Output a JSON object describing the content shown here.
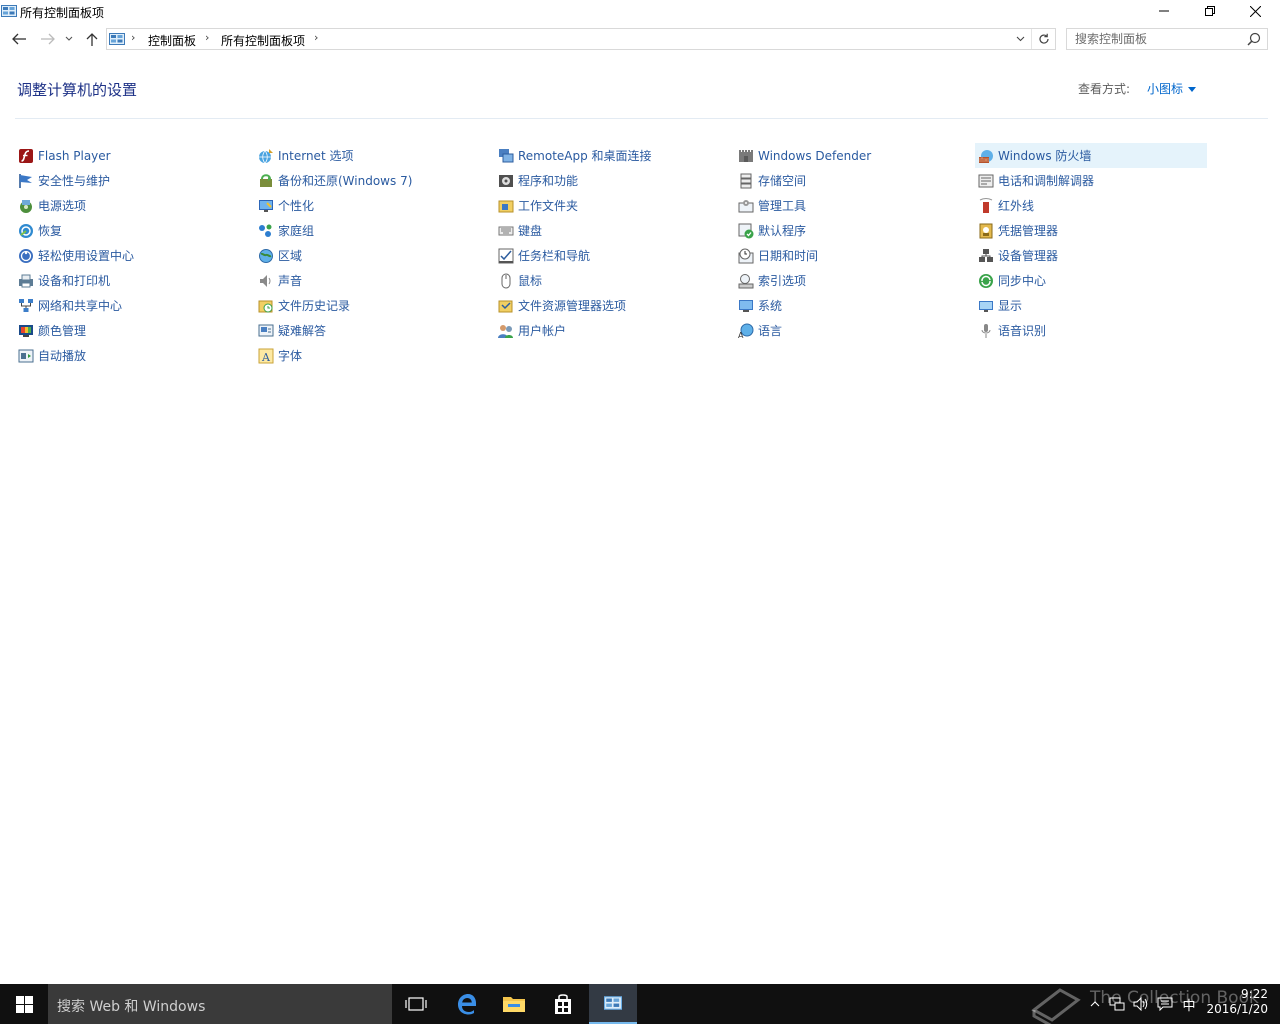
{
  "window": {
    "title": "所有控制面板项",
    "minimize_icon": "minimize-icon",
    "restore_icon": "restore-icon",
    "close_icon": "close-icon"
  },
  "address": {
    "crumbs": [
      "控制面板",
      "所有控制面板项"
    ],
    "separator": "›"
  },
  "search": {
    "placeholder": "搜索控制面板"
  },
  "content": {
    "heading": "调整计算机的设置",
    "view_by_label": "查看方式:",
    "view_by_value": "小图标"
  },
  "columns": [
    [
      {
        "label": "Flash Player",
        "icon": "flash-icon"
      },
      {
        "label": "安全性与维护",
        "icon": "flag-icon"
      },
      {
        "label": "电源选项",
        "icon": "power-icon"
      },
      {
        "label": "恢复",
        "icon": "recovery-icon"
      },
      {
        "label": "轻松使用设置中心",
        "icon": "ease-of-access-icon"
      },
      {
        "label": "设备和打印机",
        "icon": "printer-icon"
      },
      {
        "label": "网络和共享中心",
        "icon": "network-icon"
      },
      {
        "label": "颜色管理",
        "icon": "color-icon"
      },
      {
        "label": "自动播放",
        "icon": "autoplay-icon"
      }
    ],
    [
      {
        "label": "Internet 选项",
        "icon": "internet-icon"
      },
      {
        "label": "备份和还原(Windows 7)",
        "icon": "backup-icon"
      },
      {
        "label": "个性化",
        "icon": "personalize-icon"
      },
      {
        "label": "家庭组",
        "icon": "homegroup-icon"
      },
      {
        "label": "区域",
        "icon": "region-icon"
      },
      {
        "label": "声音",
        "icon": "sound-icon"
      },
      {
        "label": "文件历史记录",
        "icon": "file-history-icon"
      },
      {
        "label": "疑难解答",
        "icon": "troubleshoot-icon"
      },
      {
        "label": "字体",
        "icon": "font-icon"
      }
    ],
    [
      {
        "label": "RemoteApp 和桌面连接",
        "icon": "remoteapp-icon"
      },
      {
        "label": "程序和功能",
        "icon": "programs-icon"
      },
      {
        "label": "工作文件夹",
        "icon": "work-folders-icon"
      },
      {
        "label": "键盘",
        "icon": "keyboard-icon"
      },
      {
        "label": "任务栏和导航",
        "icon": "taskbar-icon"
      },
      {
        "label": "鼠标",
        "icon": "mouse-icon"
      },
      {
        "label": "文件资源管理器选项",
        "icon": "folder-options-icon"
      },
      {
        "label": "用户帐户",
        "icon": "users-icon"
      }
    ],
    [
      {
        "label": "Windows Defender",
        "icon": "defender-icon"
      },
      {
        "label": "存储空间",
        "icon": "storage-icon"
      },
      {
        "label": "管理工具",
        "icon": "admin-tools-icon"
      },
      {
        "label": "默认程序",
        "icon": "default-programs-icon"
      },
      {
        "label": "日期和时间",
        "icon": "clock-icon"
      },
      {
        "label": "索引选项",
        "icon": "indexing-icon"
      },
      {
        "label": "系统",
        "icon": "system-icon"
      },
      {
        "label": "语言",
        "icon": "language-icon"
      }
    ],
    [
      {
        "label": "Windows 防火墙",
        "icon": "firewall-icon",
        "hover": true
      },
      {
        "label": "电话和调制解调器",
        "icon": "phone-modem-icon"
      },
      {
        "label": "红外线",
        "icon": "infrared-icon"
      },
      {
        "label": "凭据管理器",
        "icon": "credential-icon"
      },
      {
        "label": "设备管理器",
        "icon": "device-manager-icon"
      },
      {
        "label": "同步中心",
        "icon": "sync-icon"
      },
      {
        "label": "显示",
        "icon": "display-icon"
      },
      {
        "label": "语音识别",
        "icon": "microphone-icon"
      }
    ]
  ],
  "taskbar": {
    "search_text": "搜索 Web 和 Windows",
    "watermark": "The Collection Book",
    "time": "9:22",
    "date": "2016/1/20",
    "ime": "中"
  }
}
